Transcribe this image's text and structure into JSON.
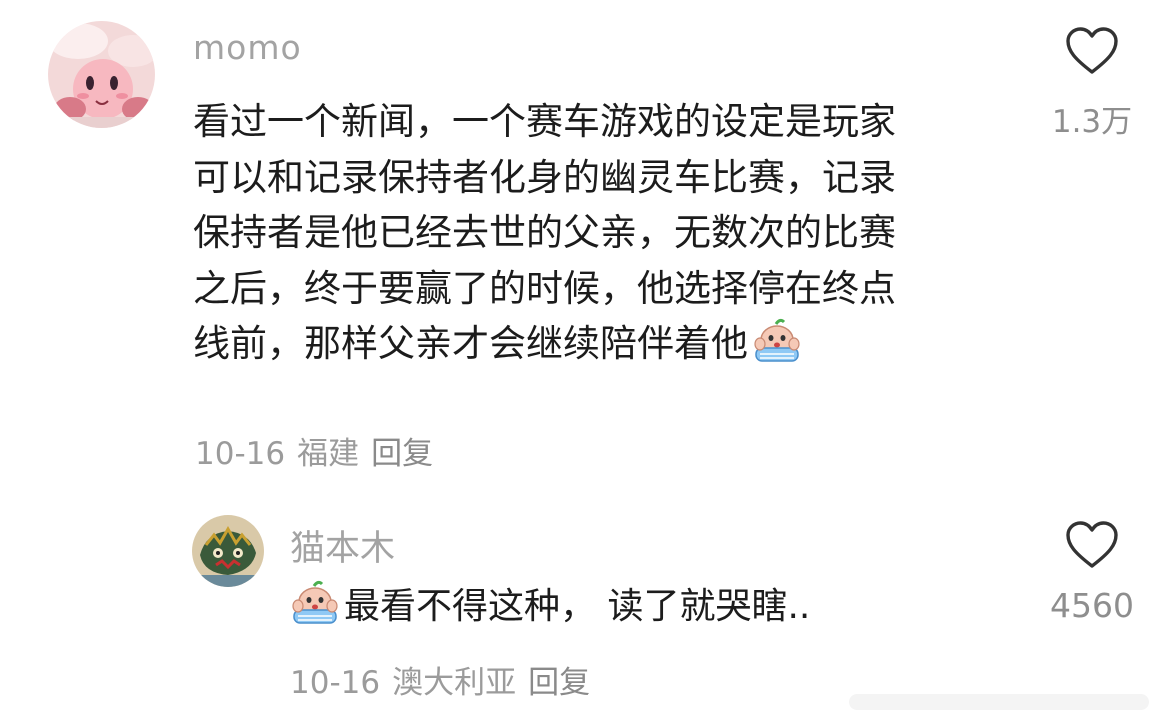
{
  "comments": [
    {
      "username": "momo",
      "lines": [
        "看过一个新闻，一个赛车游戏的设定是玩家",
        "可以和记录保持者化身的幽灵车比赛，记录",
        "保持者是他已经去世的父亲，无数次的比赛",
        "之后，终于要赢了的时候，他选择停在终点",
        "线前，那样父亲才会继续陪伴着他"
      ],
      "trailing_emoji": "crying-face-emoji",
      "date": "10-16",
      "location": "福建",
      "reply_label": "回复",
      "like_count": "1.3万",
      "like_icon": "heart-outline-icon"
    },
    {
      "username": "猫本木",
      "leading_emoji": "crying-face-emoji",
      "text": "最看不得这种， 读了就哭瞎..",
      "date": "10-16",
      "location": "澳大利亚",
      "reply_label": "回复",
      "like_count": "4560",
      "like_icon": "heart-outline-icon"
    }
  ],
  "colors": {
    "username": "#a3a3a3",
    "text": "#1c1c1c",
    "meta": "#9b9b9b",
    "icon": "#333333"
  }
}
